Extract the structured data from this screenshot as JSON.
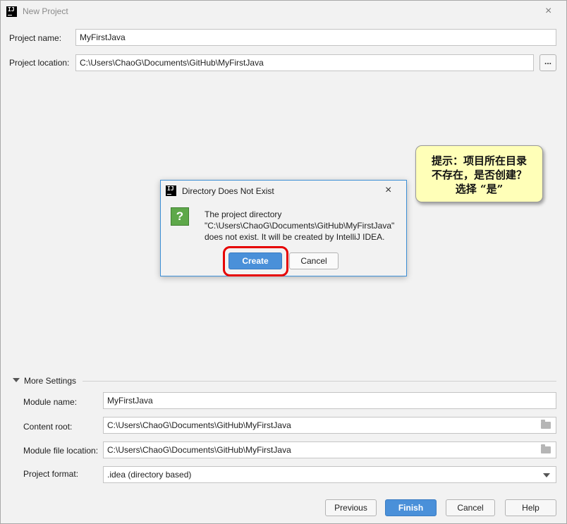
{
  "window": {
    "title": "New Project",
    "app_icon_text": "IJ"
  },
  "form": {
    "project_name_label": "Project name:",
    "project_name_value": "MyFirstJava",
    "project_location_label": "Project location:",
    "project_location_value": "C:\\Users\\ChaoG\\Documents\\GitHub\\MyFirstJava",
    "browse_label": "..."
  },
  "more_settings": {
    "header": "More Settings",
    "module_name_label": "Module name:",
    "module_name_value": "MyFirstJava",
    "content_root_label": "Content root:",
    "content_root_value": "C:\\Users\\ChaoG\\Documents\\GitHub\\MyFirstJava",
    "module_file_location_label": "Module file location:",
    "module_file_location_value": "C:\\Users\\ChaoG\\Documents\\GitHub\\MyFirstJava",
    "project_format_label": "Project format:",
    "project_format_value": ".idea (directory based)"
  },
  "footer": {
    "previous": "Previous",
    "finish": "Finish",
    "cancel": "Cancel",
    "help": "Help"
  },
  "dialog": {
    "title": "Directory Does Not Exist",
    "icon_glyph": "?",
    "message_line1": "The project directory",
    "message_line2": "\"C:\\Users\\ChaoG\\Documents\\GitHub\\MyFirstJava\"",
    "message_line3": "does not exist. It will be created by IntelliJ IDEA.",
    "create_label": "Create",
    "cancel_label": "Cancel"
  },
  "callout": {
    "line1": "提示：项目所在目录",
    "line2": "不存在，是否创建？",
    "line3": "选择 “是”"
  },
  "icons": {
    "close": "×"
  },
  "colors": {
    "primary_button": "#4a90d9",
    "highlight_ring": "#e60000",
    "callout_bg": "#ffffb8",
    "question_icon": "#5ea84a"
  }
}
